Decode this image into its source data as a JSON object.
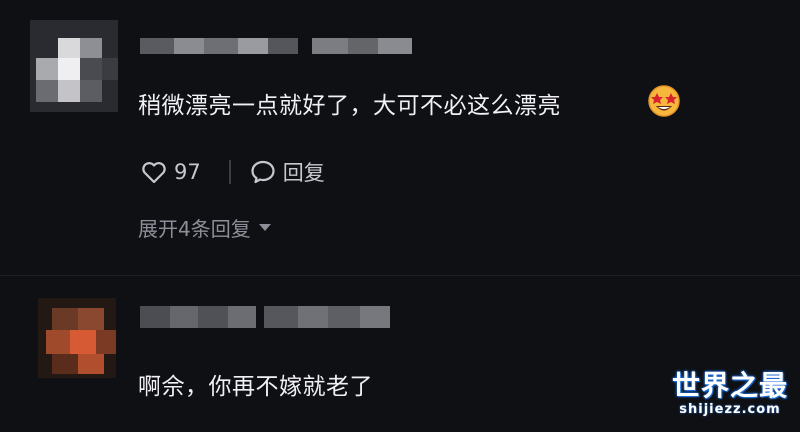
{
  "comments": [
    {
      "text": "稍微漂亮一点就好了，大可不必这么漂亮",
      "emoji": "star-struck-emoji",
      "likes": "97",
      "reply_label": "回复",
      "expand_label": "展开4条回复"
    },
    {
      "text": "啊佘，你再不嫁就老了"
    }
  ],
  "watermark": {
    "top": "世界之最",
    "bottom": "shijiezz.com"
  },
  "colors": {
    "background": "#0f1014",
    "text": "#f1f1f4",
    "secondary": "#8d8e97",
    "watermark_outline": "#1d6fd8"
  }
}
